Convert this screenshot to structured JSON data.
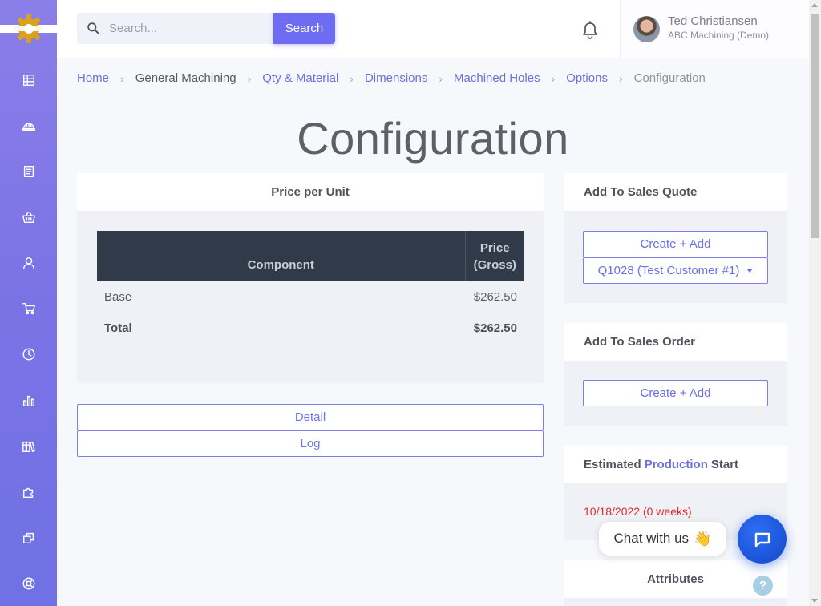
{
  "header": {
    "search_placeholder": "Search...",
    "search_button": "Search",
    "user_name": "Ted Christiansen",
    "user_company": "ABC Machining (Demo)"
  },
  "sidebar": {
    "icons": [
      "building-icon",
      "hardhat-icon",
      "document-icon",
      "basket-icon",
      "user-icon",
      "cart-icon",
      "clock-icon",
      "bar-chart-icon",
      "books-icon",
      "puzzle-icon",
      "layers-icon",
      "life-ring-icon"
    ]
  },
  "breadcrumb": [
    "Home",
    "General Machining",
    "Qty & Material",
    "Dimensions",
    "Machined Holes",
    "Options",
    "Configuration"
  ],
  "page_title": "Configuration",
  "price_card": {
    "title": "Price per Unit",
    "col_component": "Component",
    "col_price_line1": "Price",
    "col_price_line2": "(Gross)",
    "rows": [
      {
        "component": "Base",
        "price": "$262.50"
      }
    ],
    "total_label": "Total",
    "total_value": "$262.50"
  },
  "buttons": {
    "detail": "Detail",
    "log": "Log"
  },
  "sales_quote": {
    "title": "Add To Sales Quote",
    "create": "Create + Add",
    "selected_quote": "Q1028 (Test Customer #1)"
  },
  "sales_order": {
    "title": "Add To Sales Order",
    "create": "Create + Add"
  },
  "production": {
    "title_pre": "Estimated",
    "title_accent": "Production",
    "title_post": "Start",
    "date": "10/18/2022 (0 weeks)"
  },
  "attributes": {
    "title": "Attributes"
  },
  "chat": {
    "label": "Chat with us",
    "emoji": "👋",
    "help": "?"
  },
  "colors": {
    "accent": "#6d6cf3",
    "sidebar": "#7a73e6",
    "table_header": "#313a48",
    "alert_date": "#e02a2a"
  }
}
